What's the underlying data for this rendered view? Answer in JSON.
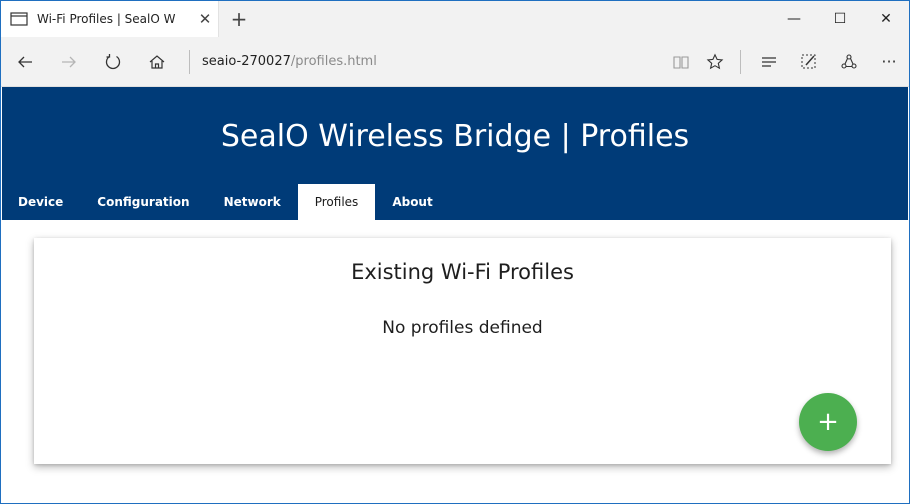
{
  "browser": {
    "tab_title": "Wi-Fi Profiles | SealO W",
    "tab_close": "✕",
    "new_tab": "+",
    "window_controls": {
      "minimize": "—",
      "maximize": "☐",
      "close": "✕"
    },
    "address_host": "seaio-270027",
    "address_path": "/profiles.html",
    "more": "···",
    "icons": [
      "tab-page-icon",
      "back-icon",
      "forward-icon",
      "refresh-icon",
      "home-icon",
      "reading-view-icon",
      "favorite-star-icon",
      "hub-icon",
      "web-note-icon",
      "share-icon",
      "more-icon"
    ]
  },
  "page": {
    "header_title": "SealO Wireless Bridge | Profiles",
    "menu": [
      {
        "label": "Device",
        "active": false
      },
      {
        "label": "Configuration",
        "active": false
      },
      {
        "label": "Network",
        "active": false
      },
      {
        "label": "Profiles",
        "active": true
      },
      {
        "label": "About",
        "active": false
      }
    ],
    "card_title": "Existing Wi-Fi Profiles",
    "empty_message": "No profiles defined",
    "add_button": "+"
  },
  "colors": {
    "header_bg": "#003b78",
    "fab_bg": "#4caf50",
    "chrome_bg": "#f2f2f2"
  }
}
